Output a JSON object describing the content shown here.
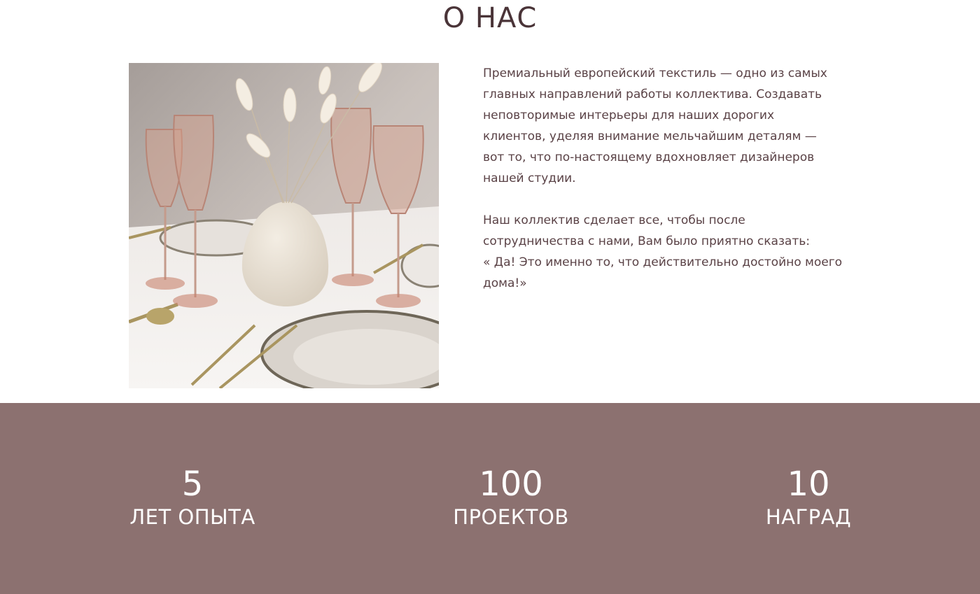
{
  "about": {
    "title": "О НАС",
    "paragraphs": [
      "Премиальный европейский текстиль — одно из самых\nглавных направлений работы коллектива. Создавать\nнеповторимые интерьеры для наших дорогих\nклиентов, уделяя внимание мельчайшим деталям —\nвот то,  что по-настоящему вдохновляет дизайнеров\nнашей студии.",
      "Наш коллектив сделает все, чтобы после\nсотрудничества с нами,  Вам было приятно сказать:\n« Да! Это именно то, что действительно достойно моего\nдома!»"
    ]
  },
  "stats": [
    {
      "value": "5",
      "label": "ЛЕТ ОПЫТА"
    },
    {
      "value": "100",
      "label": "ПРОЕКТОВ"
    },
    {
      "value": "10",
      "label": "НАГРАД"
    }
  ],
  "colors": {
    "heading": "#4a3438",
    "body_text": "#5a4246",
    "stats_background": "#8c7170",
    "stats_text": "#ffffff"
  }
}
